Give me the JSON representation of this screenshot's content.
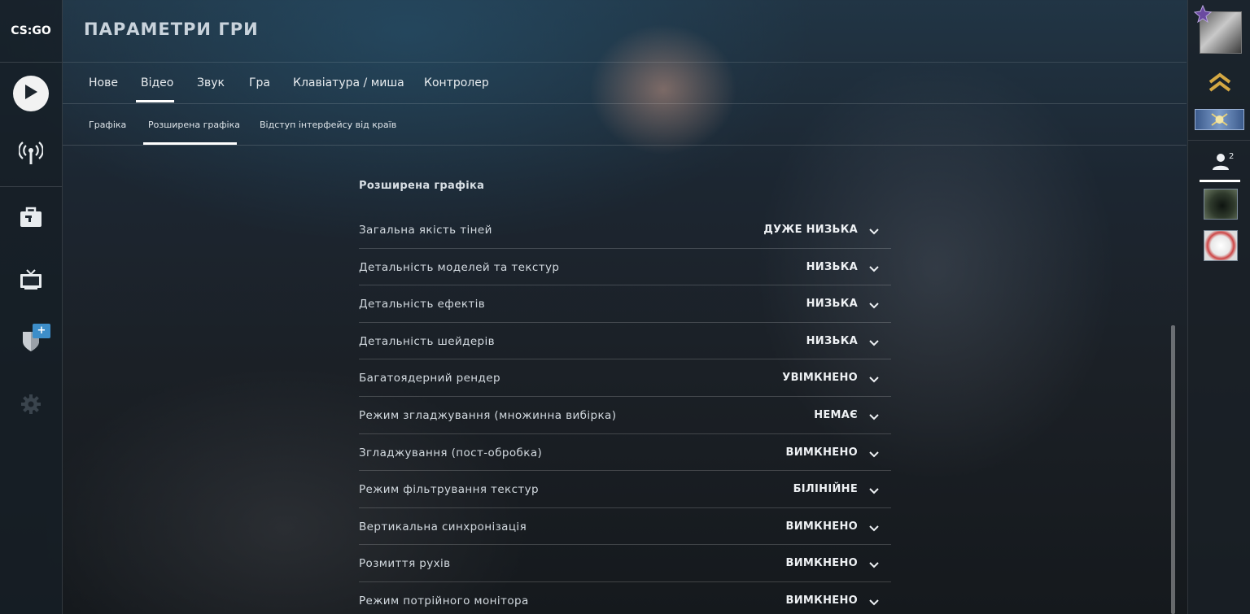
{
  "app": {
    "logo_text": "CS:GO",
    "title": "ПАРАМЕТРИ ГРИ"
  },
  "tabs": [
    {
      "label": "Нове"
    },
    {
      "label": "Відео",
      "active": true
    },
    {
      "label": "Звук"
    },
    {
      "label": "Гра"
    },
    {
      "label": "Клавіатура / миша"
    },
    {
      "label": "Контролер"
    }
  ],
  "subtabs": [
    {
      "label": "Графіка"
    },
    {
      "label": "Розширена графіка",
      "active": true
    },
    {
      "label": "Відступ інтерфейсу від країв"
    }
  ],
  "section": {
    "title": "Розширена графіка"
  },
  "settings": [
    {
      "label": "Загальна якість тіней",
      "value": "ДУЖЕ НИЗЬКА"
    },
    {
      "label": "Детальність моделей та текстур",
      "value": "НИЗЬКА"
    },
    {
      "label": "Детальність ефектів",
      "value": "НИЗЬКА"
    },
    {
      "label": "Детальність шейдерів",
      "value": "НИЗЬКА"
    },
    {
      "label": "Багатоядерний рендер",
      "value": "УВІМКНЕНО"
    },
    {
      "label": "Режим згладжування (множинна вибірка)",
      "value": "НЕМАЄ"
    },
    {
      "label": "Згладжування (пост-обробка)",
      "value": "ВИМКНЕНО"
    },
    {
      "label": "Режим фільтрування текстур",
      "value": "БІЛІНІЙНЕ"
    },
    {
      "label": "Вертикальна синхронізація",
      "value": "ВИМКНЕНО"
    },
    {
      "label": "Розмиття рухів",
      "value": "ВИМКНЕНО"
    },
    {
      "label": "Режим потрійного монітора",
      "value": "ВИМКНЕНО"
    }
  ],
  "sidebar": {
    "items": [
      {
        "icon": "play-icon"
      },
      {
        "icon": "broadcast-icon"
      },
      {
        "icon": "inventory-briefcase-icon"
      },
      {
        "icon": "tv-icon"
      },
      {
        "icon": "shield-icon",
        "badge": "+"
      },
      {
        "icon": "gear-icon"
      }
    ]
  },
  "right_sidebar": {
    "friends_count": "2"
  },
  "colors": {
    "accent": "#ffffff",
    "badge": "#3d8ec9"
  }
}
